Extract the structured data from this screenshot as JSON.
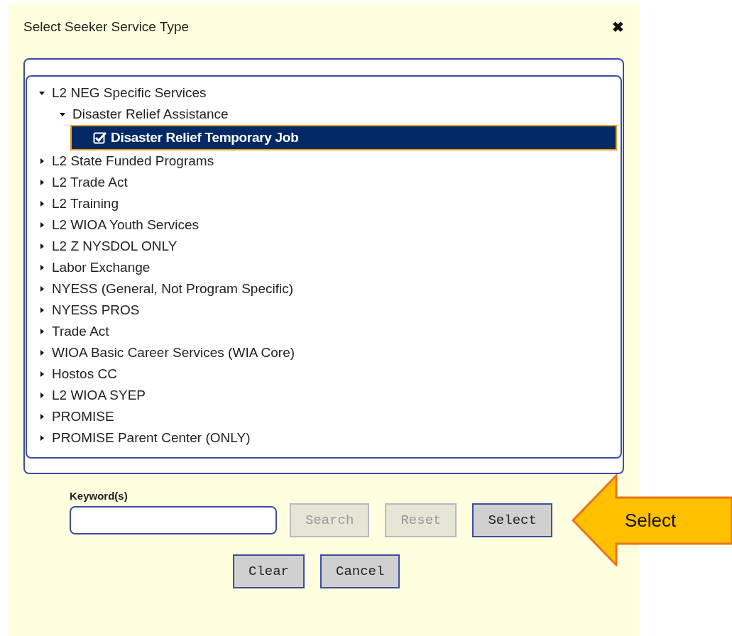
{
  "dialog": {
    "title": "Select Seeker Service Type",
    "close": "✖"
  },
  "tree": [
    {
      "label": "L2 NEG Specific Services",
      "expanded": true,
      "selected": false,
      "children": [
        {
          "label": "Disaster Relief Assistance",
          "expanded": true,
          "selected": false,
          "children": [
            {
              "label": "Disaster Relief Temporary Job",
              "checked": true,
              "selected": true
            }
          ]
        }
      ]
    },
    {
      "label": "L2 State Funded Programs",
      "expanded": false,
      "selected": false
    },
    {
      "label": "L2 Trade Act",
      "expanded": false,
      "selected": false
    },
    {
      "label": "L2 Training",
      "expanded": false,
      "selected": false
    },
    {
      "label": "L2 WIOA Youth Services",
      "expanded": false,
      "selected": false
    },
    {
      "label": "L2 Z NYSDOL ONLY",
      "expanded": false,
      "selected": false
    },
    {
      "label": "Labor Exchange",
      "expanded": false,
      "selected": false
    },
    {
      "label": "NYESS (General, Not Program Specific)",
      "expanded": false,
      "selected": false
    },
    {
      "label": "NYESS PROS",
      "expanded": false,
      "selected": false
    },
    {
      "label": "Trade Act",
      "expanded": false,
      "selected": false
    },
    {
      "label": "WIOA Basic Career Services (WIA Core)",
      "expanded": false,
      "selected": false
    },
    {
      "label": "Hostos CC",
      "expanded": false,
      "selected": false
    },
    {
      "label": "L2 WIOA SYEP",
      "expanded": false,
      "selected": false
    },
    {
      "label": "PROMISE",
      "expanded": false,
      "selected": false
    },
    {
      "label": "PROMISE Parent Center (ONLY)",
      "expanded": false,
      "selected": false
    }
  ],
  "keyword": {
    "label": "Keyword(s)"
  },
  "buttons": [
    {
      "label": "Search",
      "disabled": true
    },
    {
      "label": "Reset",
      "disabled": true
    },
    {
      "label": "Select",
      "disabled": false
    }
  ],
  "buttons_row_2": [
    {
      "label": "Clear",
      "disabled": false
    },
    {
      "label": "Cancel",
      "disabled": false
    }
  ],
  "callout": {
    "label": "Select"
  }
}
